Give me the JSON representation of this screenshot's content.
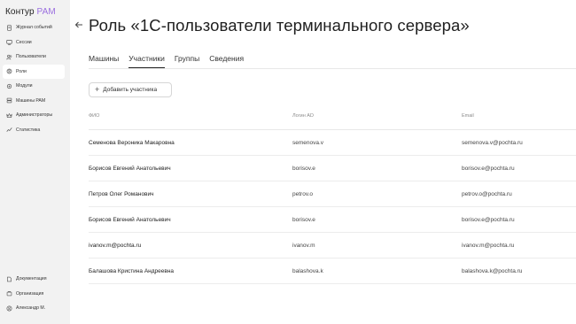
{
  "app": {
    "logo_main": "Контур",
    "logo_accent": "PAM"
  },
  "sidebar": {
    "items": [
      {
        "label": "Журнал событий",
        "icon": "journal-icon",
        "active": false
      },
      {
        "label": "Сессии",
        "icon": "sessions-icon",
        "active": false
      },
      {
        "label": "Пользователи",
        "icon": "users-icon",
        "active": false
      },
      {
        "label": "Роли",
        "icon": "roles-icon",
        "active": true
      },
      {
        "label": "Модули",
        "icon": "modules-icon",
        "active": false
      },
      {
        "label": "Машины PAM",
        "icon": "machines-icon",
        "active": false
      },
      {
        "label": "Администраторы",
        "icon": "admins-icon",
        "active": false
      },
      {
        "label": "Статистика",
        "icon": "statistics-icon",
        "active": false
      }
    ],
    "bottom": [
      {
        "label": "Документация",
        "icon": "documentation-icon"
      },
      {
        "label": "Организация",
        "icon": "organization-icon"
      },
      {
        "label": "Александр М.",
        "icon": "user-icon"
      }
    ]
  },
  "header": {
    "title": "Роль «1С-пользователи терминального сервера»"
  },
  "tabs": [
    {
      "label": "Машины",
      "active": false
    },
    {
      "label": "Участники",
      "active": true
    },
    {
      "label": "Группы",
      "active": false
    },
    {
      "label": "Сведения",
      "active": false
    }
  ],
  "toolbar": {
    "add_label": "Добавить участника"
  },
  "table": {
    "columns": [
      "ФИО",
      "Логин AD",
      "Email"
    ],
    "rows": [
      [
        "Семенова Вероника Макаровна",
        "semenova.v",
        "semenova.v@pochta.ru"
      ],
      [
        "Борисов Евгений Анатольевич",
        "borisov.e",
        "borisov.e@pochta.ru"
      ],
      [
        "Петров Олег Романович",
        "petrov.o",
        "petrov.o@pochta.ru"
      ],
      [
        "Борисов Евгений Анатольевич",
        "borisov.e",
        "borisov.e@pochta.ru"
      ],
      [
        "ivanov.m@pochta.ru",
        "ivanov.m",
        "ivanov.m@pochta.ru"
      ],
      [
        "Балашова Кристина Андреевна",
        "balashova.k",
        "balashova.k@pochta.ru"
      ]
    ]
  },
  "colors": {
    "accent": "#9b6fe0",
    "sidebar_bg": "#f2f2f2"
  }
}
